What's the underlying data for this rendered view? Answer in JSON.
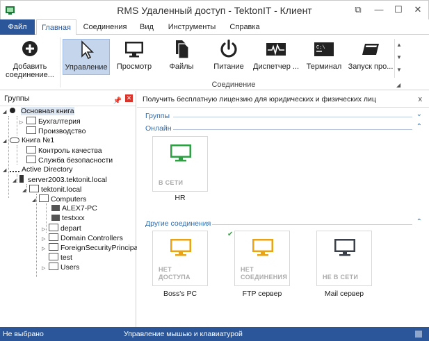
{
  "window": {
    "title": "RMS Удаленный доступ - TektonIT - Клиент",
    "colors": {
      "accent": "#2b579a",
      "online": "#2ea043",
      "offline": "#e8a317",
      "sleep": "#3a3f48"
    }
  },
  "tabs": [
    "Файл",
    "Главная",
    "Соединения",
    "Вид",
    "Инструменты",
    "Справка"
  ],
  "ribbon": {
    "add_label_1": "Добавить",
    "add_label_2": "соединение...",
    "buttons": [
      "Управление",
      "Просмотр",
      "Файлы",
      "Питание",
      "Диспетчер ...",
      "Терминал",
      "Запуск про..."
    ],
    "group_label": "Соединение"
  },
  "groups_panel": {
    "title": "Группы",
    "tree": [
      {
        "label": "Основная книга"
      },
      {
        "label": "Бухгалтерия"
      },
      {
        "label": "Производство"
      },
      {
        "label": "Книга №1"
      },
      {
        "label": "Контроль качества"
      },
      {
        "label": "Служба безопасности"
      },
      {
        "label": "Active Directory"
      },
      {
        "label": "server2003.tektonit.local"
      },
      {
        "label": "tektonit.local"
      },
      {
        "label": "Computers"
      },
      {
        "label": "ALEX7-PC"
      },
      {
        "label": "testxxx"
      },
      {
        "label": "depart"
      },
      {
        "label": "Domain Controllers"
      },
      {
        "label": "ForeignSecurityPrincipals"
      },
      {
        "label": "test"
      },
      {
        "label": "Users"
      }
    ]
  },
  "main": {
    "banner": "Получить бесплатную лицензию для юридических и физических лиц",
    "banner_close": "x",
    "sections": {
      "groups": "Группы",
      "online": "Онлайн",
      "other": "Другие соединения"
    },
    "online_cards": [
      {
        "state": "В СЕТИ",
        "name": "HR",
        "icon": "monitor-green-icon"
      }
    ],
    "other_cards": [
      {
        "state_1": "НЕТ",
        "state_2": "ДОСТУПА",
        "name": "Boss's PC",
        "icon": "monitor-orange-icon"
      },
      {
        "state_1": "НЕТ",
        "state_2": "СОЕДИНЕНИЯ",
        "name": "FTP сервер",
        "icon": "monitor-orange-icon"
      },
      {
        "state": "НЕ В СЕТИ",
        "name": "Mail сервер",
        "icon": "monitor-dark-icon"
      }
    ]
  },
  "status": {
    "left": "Не выбрано",
    "middle": "Управление мышью и клавиатурой"
  }
}
